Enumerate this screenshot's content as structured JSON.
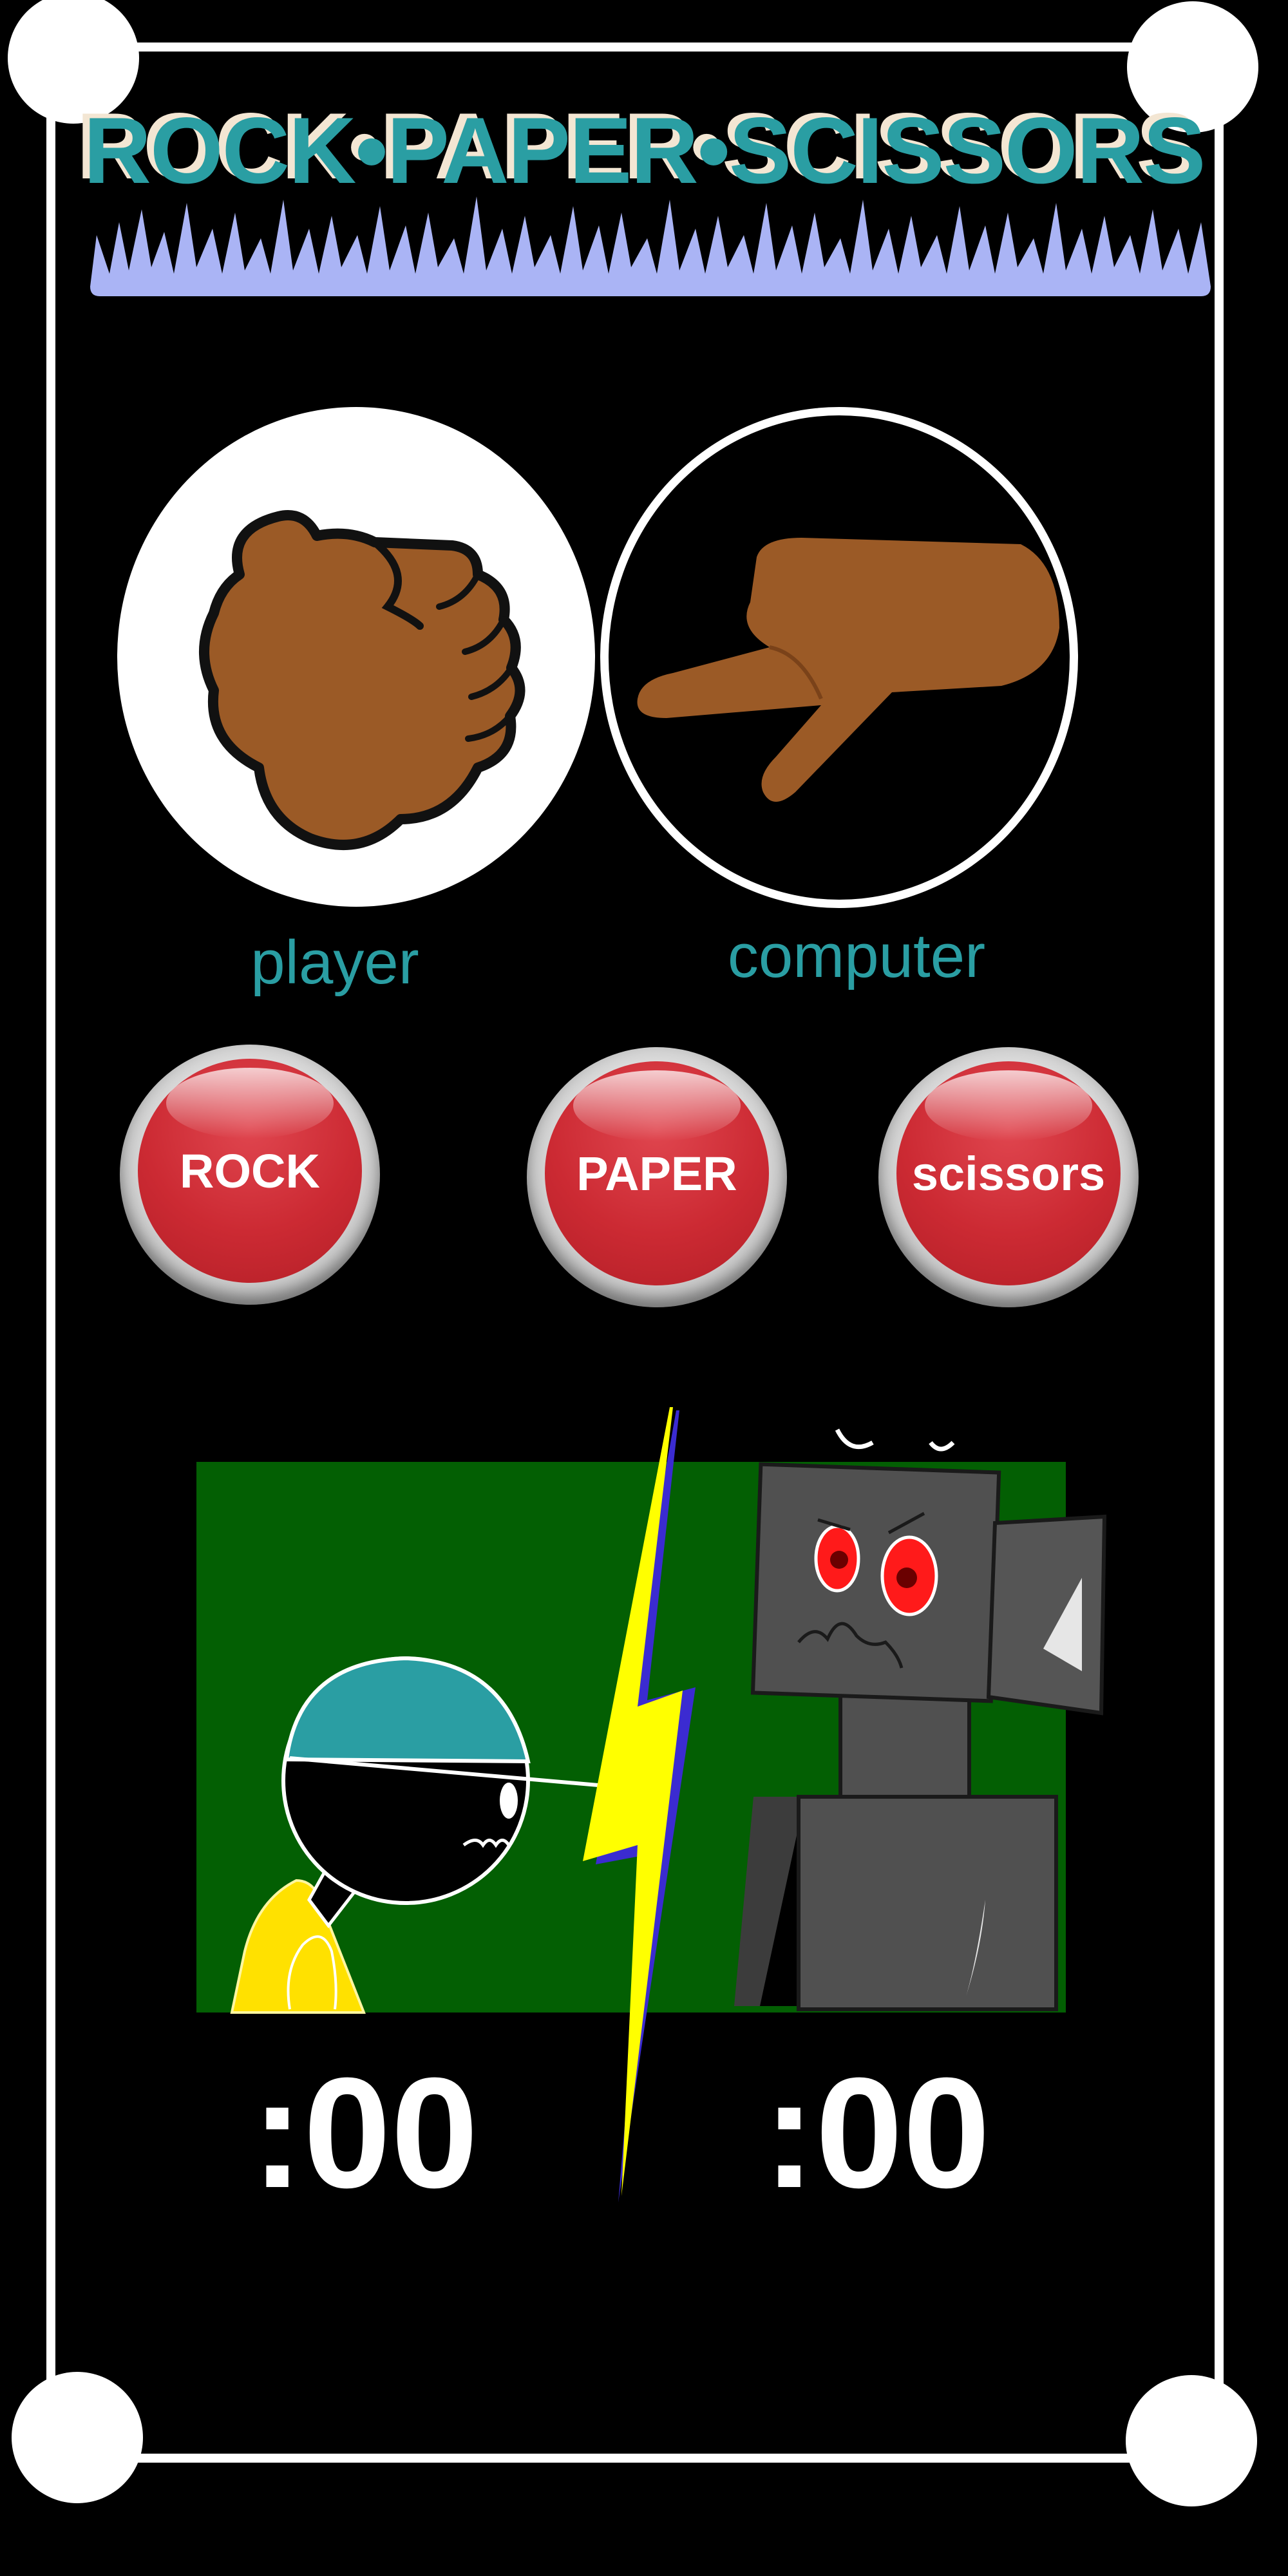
{
  "title": "ROCK•PAPER•SCISSORS",
  "players": {
    "player_label": "player",
    "computer_label": "computer",
    "player_hand": "rock",
    "computer_hand": "scissors"
  },
  "buttons": [
    {
      "label": "ROCK"
    },
    {
      "label": "PAPER"
    },
    {
      "label": "scissors"
    }
  ],
  "scores": {
    "player": ":00",
    "computer": ":00"
  },
  "colors": {
    "accent": "#2a9ea3",
    "title_shadow": "#f3e6d3",
    "grass": "#aab4f5",
    "button_red": "#cc2a33",
    "scene_green": "#035f03",
    "lightning": "#ffff00",
    "skin": "#9b5a26"
  }
}
